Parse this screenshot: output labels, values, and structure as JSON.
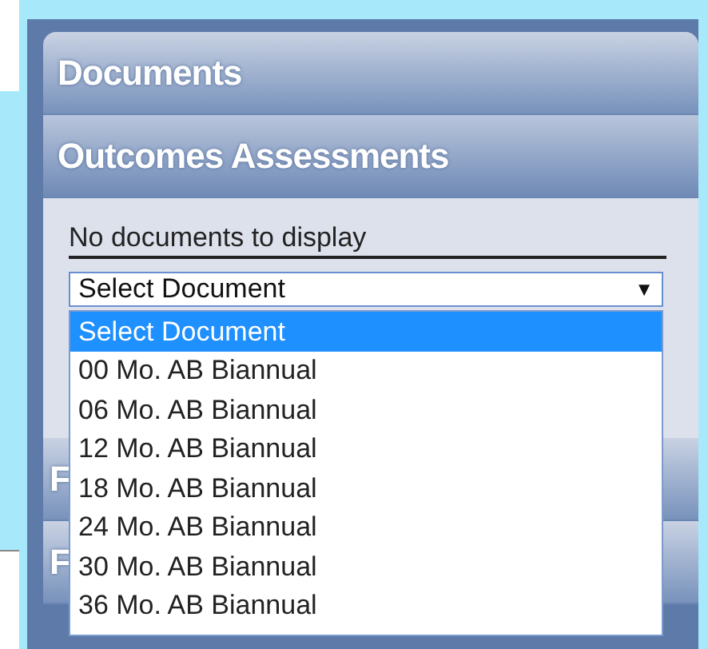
{
  "sections_top": [
    {
      "title": "Documents",
      "expanded": false
    },
    {
      "title": "Outcomes Assessments",
      "expanded": true
    }
  ],
  "content": {
    "message": "No documents to display",
    "select": {
      "value": "Select Document",
      "arrow": "▼",
      "open": true,
      "options": [
        {
          "label": "Select Document",
          "selected": true
        },
        {
          "label": "00 Mo. AB Biannual",
          "selected": false
        },
        {
          "label": "06 Mo. AB Biannual",
          "selected": false
        },
        {
          "label": "12 Mo. AB Biannual",
          "selected": false
        },
        {
          "label": "18 Mo. AB Biannual",
          "selected": false
        },
        {
          "label": "24 Mo. AB Biannual",
          "selected": false
        },
        {
          "label": "30 Mo. AB Biannual",
          "selected": false
        },
        {
          "label": "36 Mo. AB Biannual",
          "selected": false
        }
      ]
    }
  },
  "sections_bottom": [
    {
      "title": "F",
      "expanded": false
    },
    {
      "title": "F",
      "expanded": false
    }
  ]
}
